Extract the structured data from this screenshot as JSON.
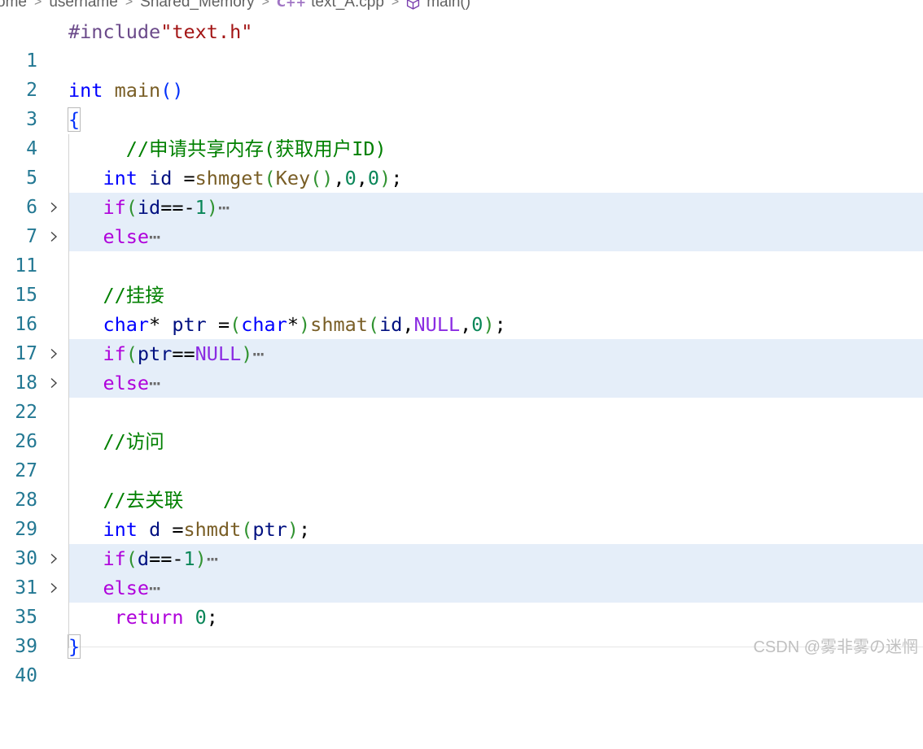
{
  "breadcrumb": {
    "items": [
      "ome",
      "username",
      "Shared_Memory",
      "text_A.cpp",
      "main()"
    ],
    "file_icon": "C++",
    "symbol_icon": "cube-icon"
  },
  "editor": {
    "lines": [
      {
        "n": "1"
      },
      {
        "n": "2"
      },
      {
        "n": "3"
      },
      {
        "n": "4"
      },
      {
        "n": "5"
      },
      {
        "n": "6"
      },
      {
        "n": "7"
      },
      {
        "n": "11"
      },
      {
        "n": "15"
      },
      {
        "n": "16"
      },
      {
        "n": "17"
      },
      {
        "n": "18"
      },
      {
        "n": "22"
      },
      {
        "n": "26"
      },
      {
        "n": "27"
      },
      {
        "n": "28"
      },
      {
        "n": "29"
      },
      {
        "n": "30"
      },
      {
        "n": "31"
      },
      {
        "n": "35"
      },
      {
        "n": "39"
      },
      {
        "n": "40"
      }
    ],
    "tokens": {
      "l1_dir": "#include",
      "l1_str": "\"text.h\"",
      "l3_type": "int",
      "l3_fn": "main",
      "l3_paren": "()",
      "l4_brace": "{",
      "l5_cmt": "//申请共享内存(获取用户ID)",
      "l6_type": "int",
      "l6_var": "id",
      "l6_eq": " =",
      "l6_fn": "shmget",
      "l6_p1": "(",
      "l6_fn2": "Key",
      "l6_p2": "()",
      "l6_c1": ",",
      "l6_n1": "0",
      "l6_c2": ",",
      "l6_n2": "0",
      "l6_p3": ")",
      "l6_semi": ";",
      "l7_if": "if",
      "l7_p": "(",
      "l7_var": "id",
      "l7_op": "==-",
      "l7_num": "1",
      "l7_pc": ")",
      "l11_else": "else",
      "l16_cmt": "//挂接",
      "l17_type": "char",
      "l17_star": "*",
      "l17_var": "ptr",
      "l17_eq": " =",
      "l17_p1": "(",
      "l17_type2": "char",
      "l17_star2": "*",
      "l17_p2": ")",
      "l17_fn": "shmat",
      "l17_p3": "(",
      "l17_var2": "id",
      "l17_c1": ",",
      "l17_macro": "NULL",
      "l17_c2": ",",
      "l17_num": "0",
      "l17_p4": ")",
      "l17_semi": ";",
      "l18_if": "if",
      "l18_p": "(",
      "l18_var": "ptr",
      "l18_op": "==",
      "l18_macro": "NULL",
      "l18_pc": ")",
      "l22_else": "else",
      "l27_cmt": "//访问",
      "l29_cmt": "//去关联",
      "l30_type": "int",
      "l30_var": "d",
      "l30_eq": " =",
      "l30_fn": "shmdt",
      "l30_p1": "(",
      "l30_var2": "ptr",
      "l30_p2": ")",
      "l30_semi": ";",
      "l31_if": "if",
      "l31_p": "(",
      "l31_var": "d",
      "l31_op": "==-",
      "l31_num": "1",
      "l31_pc": ")",
      "l35_else": "else",
      "l39_kw": "return",
      "l39_num": "0",
      "l39_semi": ";",
      "l40_brace": "}",
      "ellipsis": "⋯"
    }
  },
  "watermark": "CSDN @雾非雾の迷惘",
  "colors": {
    "line_number": "#237893",
    "folded_background": "#e5eef9",
    "comment": "#008000",
    "keyword_type": "#0000ff",
    "keyword_control": "#af00db",
    "function": "#795e26",
    "variable": "#001080",
    "number": "#098658",
    "string": "#a31515"
  }
}
